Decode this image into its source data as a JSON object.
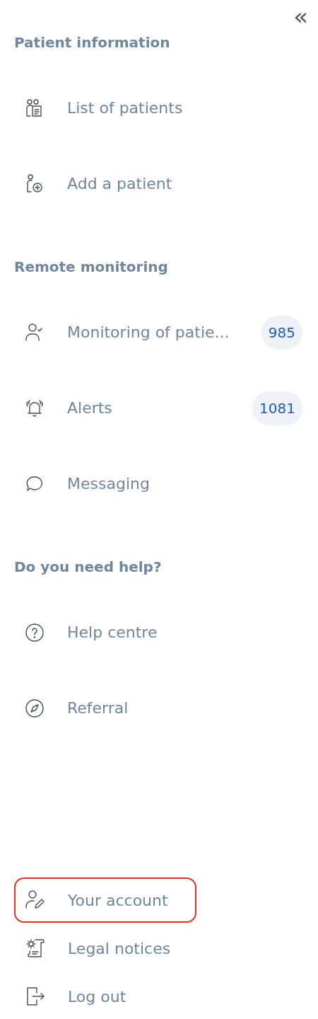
{
  "collapse_button": {
    "label": "«"
  },
  "sections": [
    {
      "title": "Patient information",
      "items": [
        {
          "label": "List of patients",
          "kind": "list"
        },
        {
          "label": "Add a patient",
          "kind": "add"
        }
      ]
    },
    {
      "title": "Remote monitoring",
      "items": [
        {
          "label": "Monitoring of patie...",
          "kind": "monitor",
          "badge": "985"
        },
        {
          "label": "Alerts",
          "kind": "alert",
          "badge": "1081"
        },
        {
          "label": "Messaging",
          "kind": "message"
        }
      ]
    },
    {
      "title": "Do you need help?",
      "items": [
        {
          "label": "Help centre",
          "kind": "help"
        },
        {
          "label": "Referral",
          "kind": "referral"
        }
      ]
    }
  ],
  "footer_items": [
    {
      "label": "Your account",
      "kind": "account",
      "highlighted": true
    },
    {
      "label": "Legal notices",
      "kind": "legal",
      "highlighted": false
    },
    {
      "label": "Log out",
      "kind": "logout",
      "highlighted": false
    }
  ]
}
